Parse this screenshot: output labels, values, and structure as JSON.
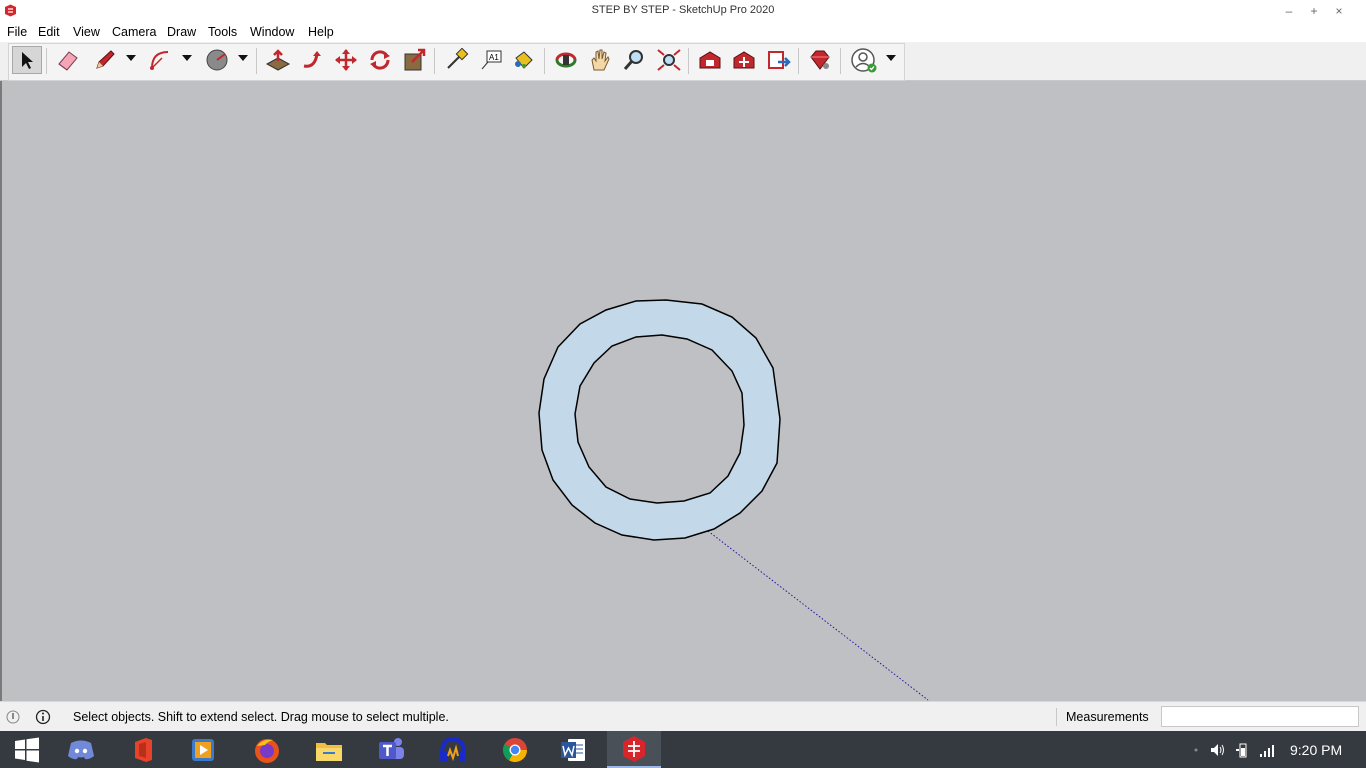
{
  "window": {
    "title": "STEP BY STEP - SketchUp Pro 2020",
    "controls": [
      "minimize-icon",
      "maximize-icon",
      "close-icon"
    ]
  },
  "menu": [
    "File",
    "Edit",
    "View",
    "Camera",
    "Draw",
    "Tools",
    "Window",
    "Help"
  ],
  "toolbar": {
    "tools": [
      "select-icon",
      "eraser-icon",
      "pencil-icon",
      "arc-icon",
      "circle-icon",
      "push-pull-icon",
      "follow-me-icon",
      "move-icon",
      "rotate-icon",
      "scale-icon",
      "tape-measure-icon",
      "text-icon",
      "paint-bucket-icon",
      "orbit-icon",
      "pan-icon",
      "zoom-icon",
      "zoom-extents-icon",
      "warehouse-icon",
      "extension-warehouse-icon",
      "send-to-layout-icon",
      "extension-manager-icon",
      "account-icon"
    ],
    "active_tool": "select-icon"
  },
  "viewport": {
    "background": "#bfc0c4",
    "face_color": "#c3d9ea",
    "edge_color": "#000000",
    "axis_color": "#1a1aa0"
  },
  "status": {
    "message": "Select objects. Shift to extend select. Drag mouse to select multiple.",
    "measurements_label": "Measurements",
    "measurements_value": ""
  },
  "taskbar": {
    "apps": [
      "windows-start-icon",
      "discord-icon",
      "office-icon",
      "media-player-icon",
      "firefox-icon",
      "file-explorer-icon",
      "teams-icon",
      "headphones-app-icon",
      "chrome-icon",
      "word-icon",
      "sketchup-icon"
    ],
    "active_app": "sketchup-icon",
    "time": "9:20 PM"
  }
}
